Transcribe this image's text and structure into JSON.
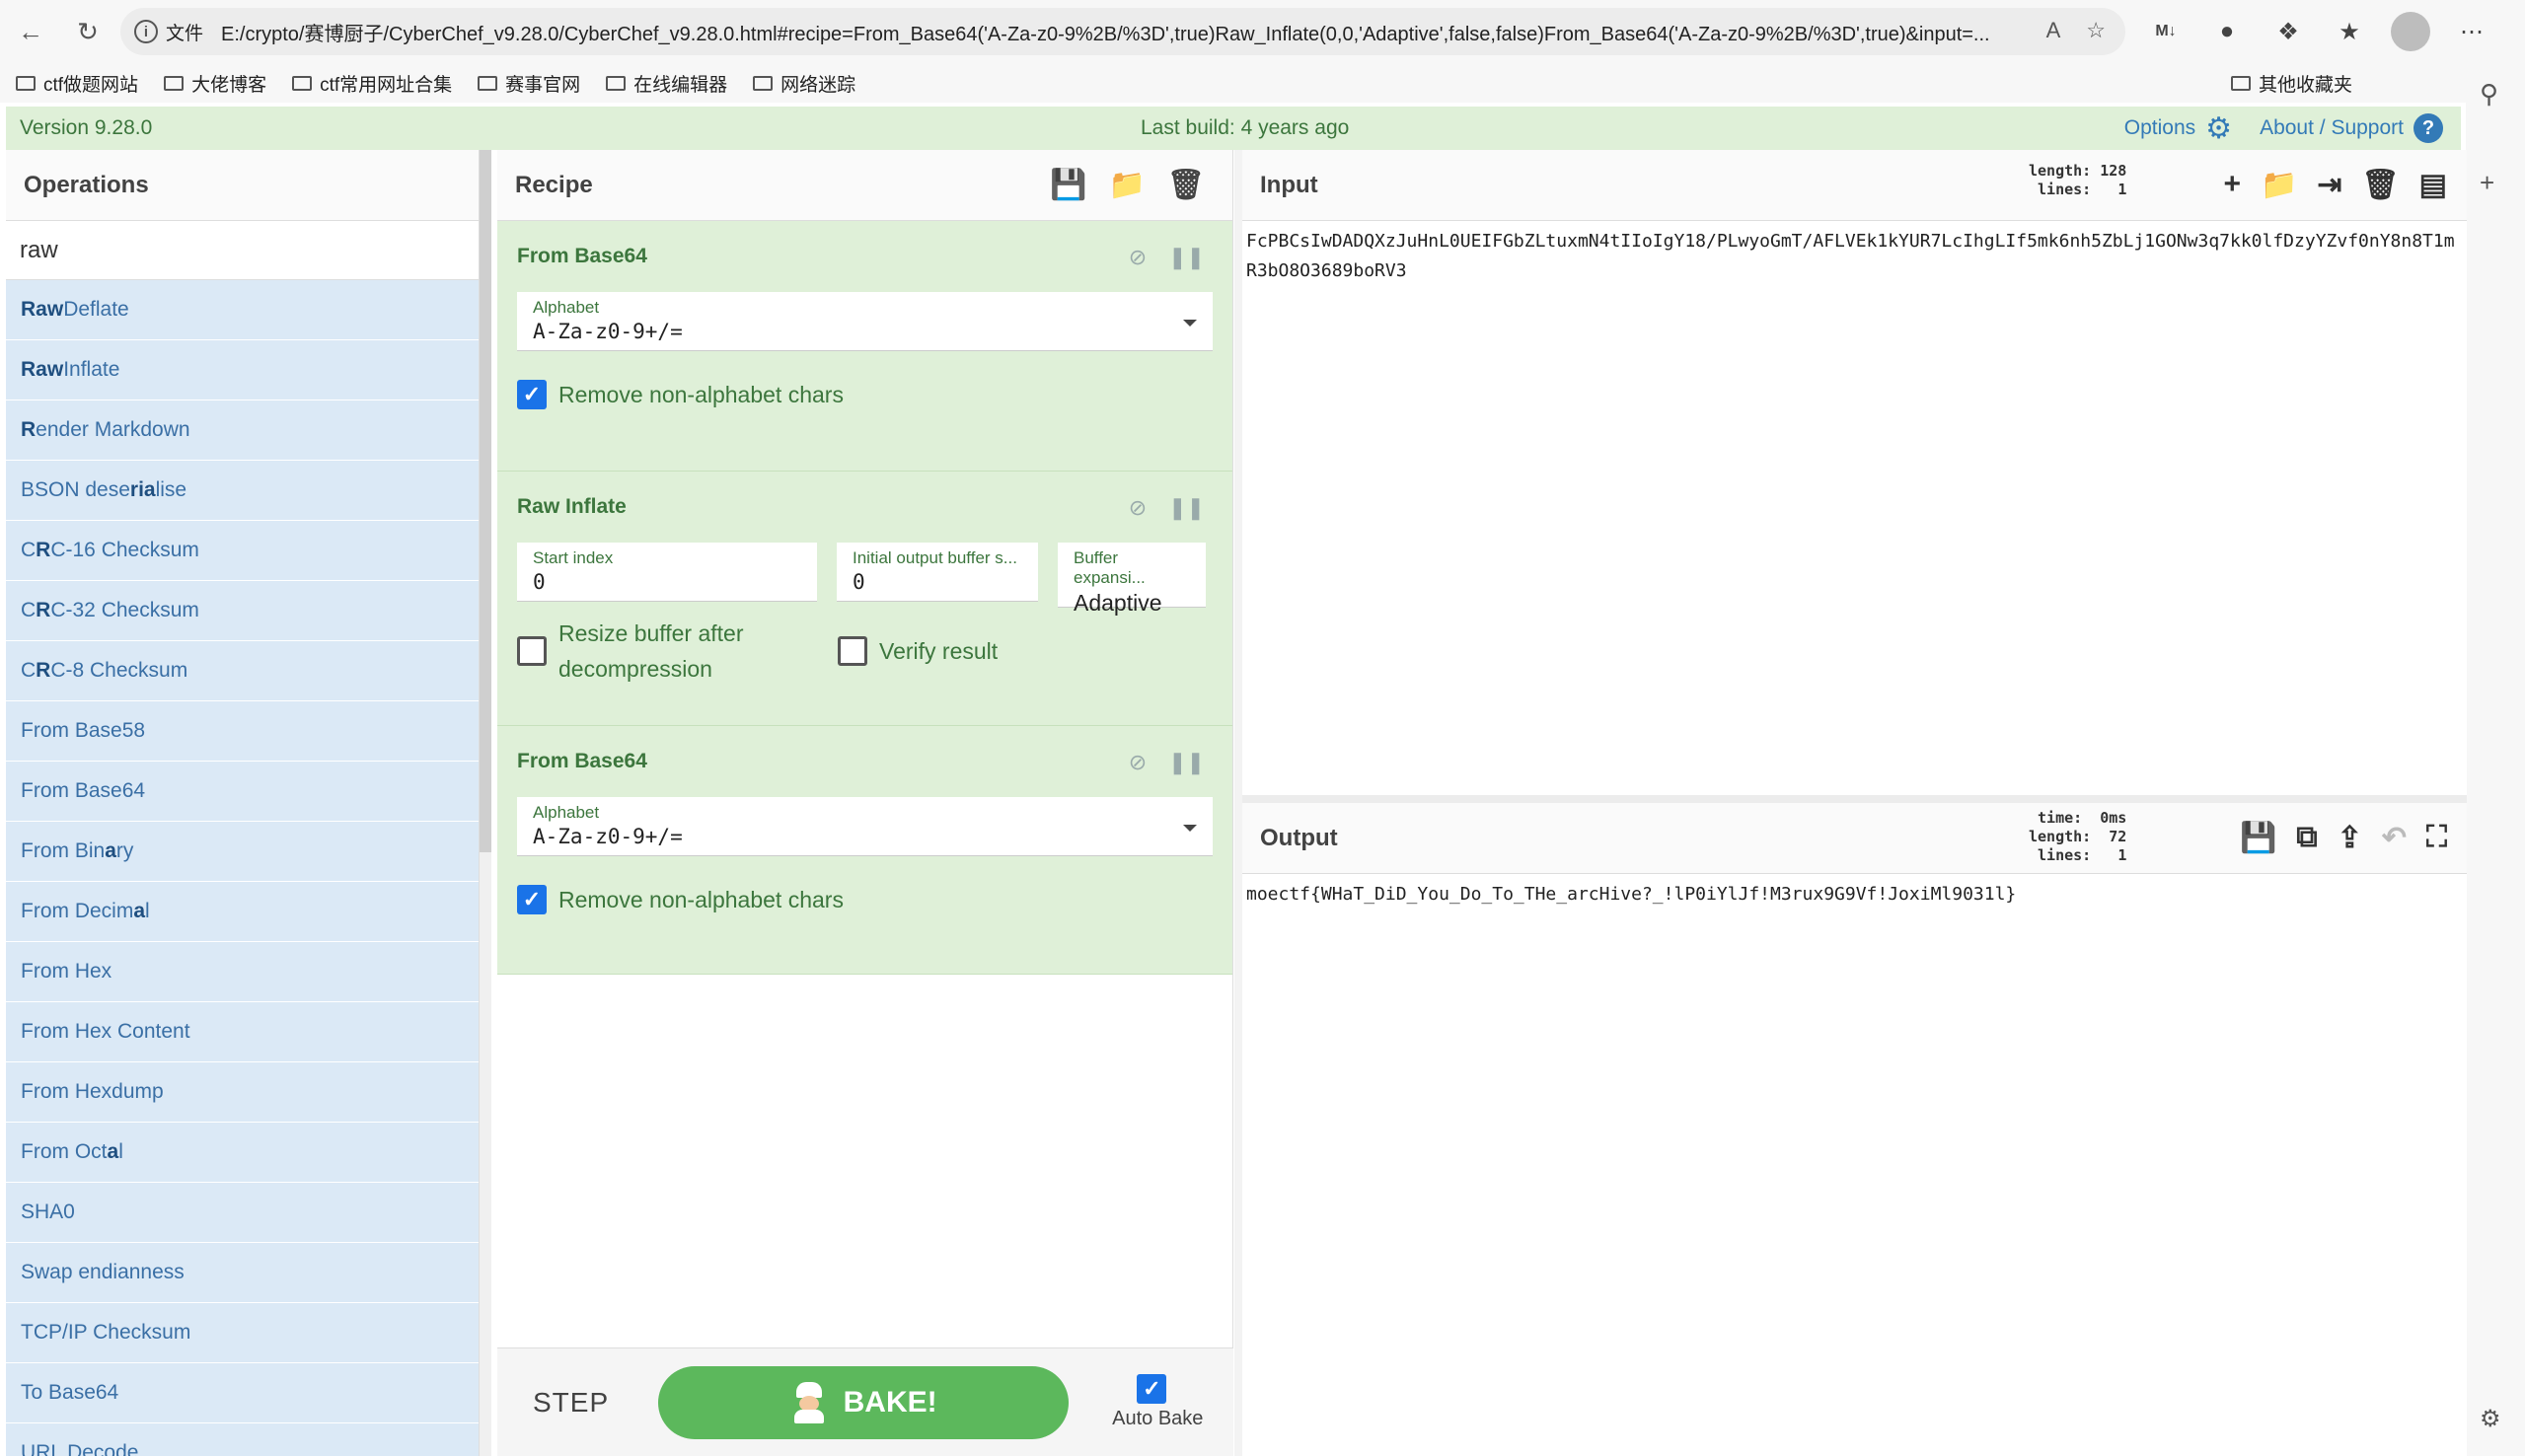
{
  "browser": {
    "address_label": "文件",
    "url": "E:/crypto/赛博厨子/CyberChef_v9.28.0/CyberChef_v9.28.0.html#recipe=From_Base64('A-Za-z0-9%2B/%3D',true)Raw_Inflate(0,0,'Adaptive',false,false)From_Base64('A-Za-z0-9%2B/%3D',true)&input=...",
    "bookmarks": [
      "ctf做题网站",
      "大佬博客",
      "ctf常用网址合集",
      "赛事官网",
      "在线编辑器",
      "网络迷踪"
    ],
    "other_bookmarks": "其他收藏夹"
  },
  "banner": {
    "version": "Version 9.28.0",
    "build": "Last build: 4 years ago",
    "options": "Options",
    "about": "About / Support"
  },
  "operations": {
    "title": "Operations",
    "search_value": "raw",
    "items": [
      {
        "pre": "",
        "hl": "Raw",
        "post": " Deflate"
      },
      {
        "pre": "",
        "hl": "Raw",
        "post": " Inflate"
      },
      {
        "pre": "",
        "hl": "R",
        "post": "ender Markdown"
      },
      {
        "pre": "BSON dese",
        "hl": "ria",
        "post": "lise"
      },
      {
        "pre": "C",
        "hl": "R",
        "post": "C-16 Checksum"
      },
      {
        "pre": "C",
        "hl": "R",
        "post": "C-32 Checksum"
      },
      {
        "pre": "C",
        "hl": "R",
        "post": "C-8 Checksum"
      },
      {
        "pre": "From Base58",
        "hl": "",
        "post": ""
      },
      {
        "pre": "From Base64",
        "hl": "",
        "post": ""
      },
      {
        "pre": "From Bin",
        "hl": "a",
        "post": "ry"
      },
      {
        "pre": "From Decim",
        "hl": "a",
        "post": "l"
      },
      {
        "pre": "From Hex",
        "hl": "",
        "post": ""
      },
      {
        "pre": "From Hex Content",
        "hl": "",
        "post": ""
      },
      {
        "pre": "From Hexdump",
        "hl": "",
        "post": ""
      },
      {
        "pre": "From Oct",
        "hl": "a",
        "post": "l"
      },
      {
        "pre": "SHA0",
        "hl": "",
        "post": ""
      },
      {
        "pre": "Swap endianness",
        "hl": "",
        "post": ""
      },
      {
        "pre": "TCP/IP Checksum",
        "hl": "",
        "post": ""
      },
      {
        "pre": "To Base64",
        "hl": "",
        "post": ""
      },
      {
        "pre": "URL Decode",
        "hl": "",
        "post": ""
      }
    ]
  },
  "recipe": {
    "title": "Recipe",
    "ing1": {
      "name": "From Base64",
      "alphabet_label": "Alphabet",
      "alphabet_value": "A-Za-z0-9+/=",
      "remove_label": "Remove non-alphabet chars"
    },
    "ing2": {
      "name": "Raw Inflate",
      "start_label": "Start index",
      "start_value": "0",
      "initbuf_label": "Initial output buffer s...",
      "initbuf_value": "0",
      "bufexp_label": "Buffer expansi...",
      "bufexp_value": "Adaptive",
      "resize_label": "Resize buffer after decompression",
      "verify_label": "Verify result"
    },
    "ing3": {
      "name": "From Base64",
      "alphabet_label": "Alphabet",
      "alphabet_value": "A-Za-z0-9+/=",
      "remove_label": "Remove non-alphabet chars"
    },
    "step": "STEP",
    "bake": "BAKE!",
    "autobake": "Auto Bake"
  },
  "input": {
    "title": "Input",
    "length_label": "length:",
    "length_value": "128",
    "lines_label": "lines:",
    "lines_value": "1",
    "text": "FcPBCsIwDADQXzJuHnL0UEIFGbZLtuxmN4tIIoIgY18/PLwyoGmT/AFLVEk1kYUR7LcIhgLIf5mk6nh5ZbLj1GONw3q7kk0lfDzyYZvf0nY8n8T1mR3bO8O3689boRV3"
  },
  "output": {
    "title": "Output",
    "time_label": "time:",
    "time_value": "0ms",
    "length_label": "length:",
    "length_value": "72",
    "lines_label": "lines:",
    "lines_value": "1",
    "text": "moectf{WHaT_DiD_You_Do_To_THe_arcHive?_!lP0iYlJf!M3rux9G9Vf!JoxiMl9031l}"
  }
}
